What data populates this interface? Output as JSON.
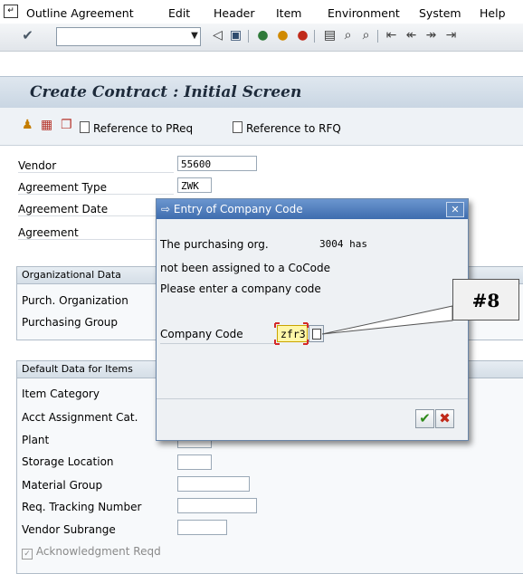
{
  "menubar": {
    "items": [
      "Outline Agreement",
      "Edit",
      "Header",
      "Item",
      "Environment",
      "System",
      "Help"
    ]
  },
  "toolbar": {
    "command_value": "",
    "icons": [
      "enter-icon",
      "back-icon",
      "save-icon",
      "back-nav-icon",
      "exit-icon",
      "cancel-icon",
      "print-icon",
      "find-icon",
      "find-next-icon",
      "first-page-icon",
      "prev-page-icon",
      "next-page-icon",
      "last-page-icon"
    ]
  },
  "title": "Create Contract : Initial Screen",
  "app_toolbar": {
    "ref_preq": "Reference to PReq",
    "ref_rfq": "Reference to RFQ"
  },
  "form": {
    "vendor_label": "Vendor",
    "vendor_value": "55600",
    "agreement_type_label": "Agreement Type",
    "agreement_type_value": "ZWK",
    "agreement_date_label": "Agreement Date",
    "agreement_label": "Agreement",
    "org_data_title": "Organizational Data",
    "purch_org_label": "Purch. Organization",
    "purch_group_label": "Purchasing Group",
    "default_data_title": "Default Data for Items",
    "item_category_label": "Item Category",
    "acct_assignment_label": "Acct Assignment Cat.",
    "plant_label": "Plant",
    "storage_location_label": "Storage Location",
    "material_group_label": "Material Group",
    "req_tracking_label": "Req. Tracking Number",
    "vendor_subrange_label": "Vendor Subrange",
    "ack_reqd_label": "Acknowledgment Reqd",
    "ack_reqd_checked": true
  },
  "dialog": {
    "title": "Entry of Company Code",
    "line1": "The purchasing org.",
    "org_value": "3004 has",
    "line2": "not been assigned to a CoCode",
    "line3": "Please enter a company code",
    "company_code_label": "Company Code",
    "company_code_value": "zfr3",
    "confirm_glyph": "✔",
    "cancel_glyph": "✖"
  },
  "callout": "#8"
}
